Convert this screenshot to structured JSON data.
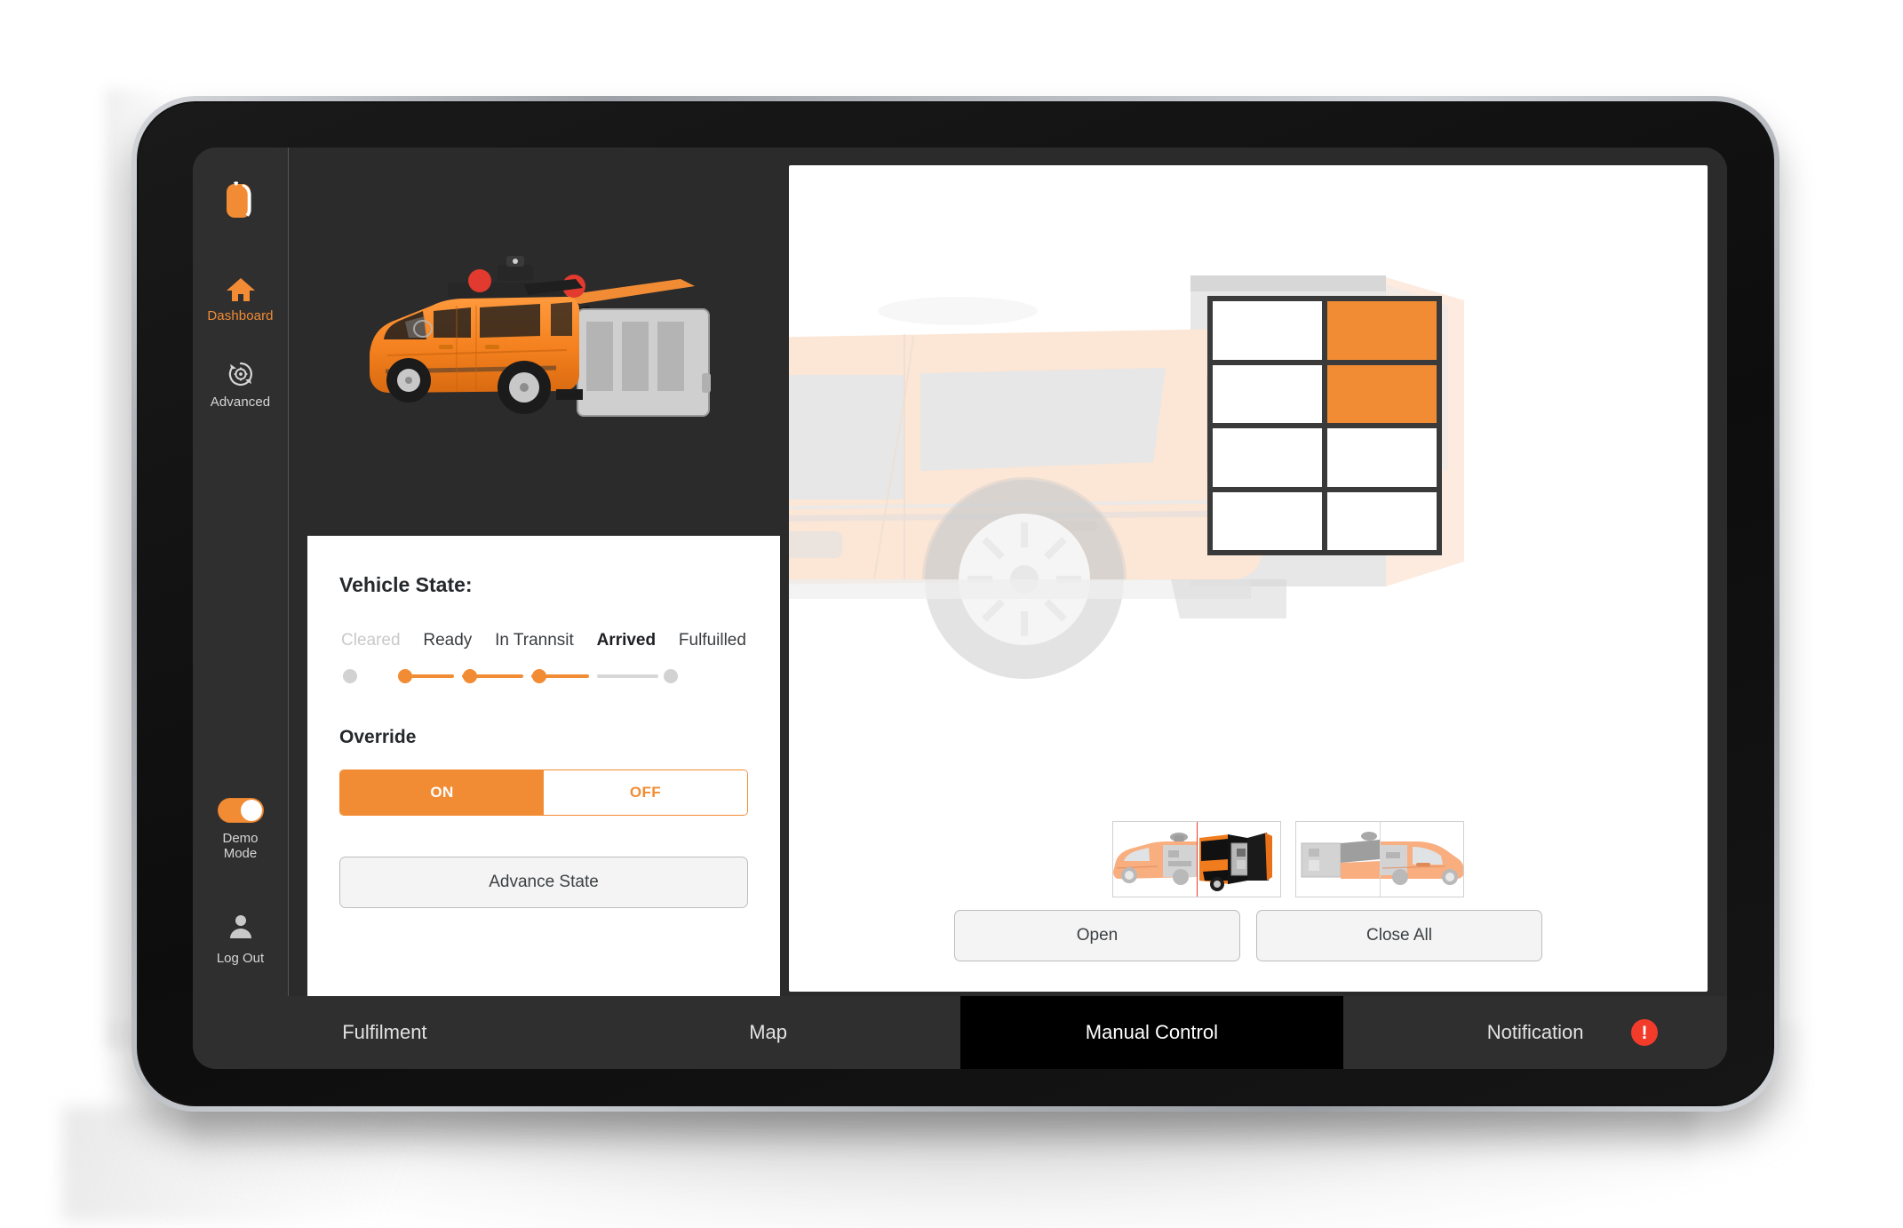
{
  "app": {
    "accent": "#F28C34",
    "screen_bg": "#2b2b2b",
    "sidebar_bg": "#2f2f2f",
    "alert_red": "#f23b2a"
  },
  "sidebar": {
    "logo_name": "app-logo",
    "items": [
      {
        "label": "Dashboard",
        "icon": "home-icon",
        "active": true
      },
      {
        "label": "Advanced",
        "icon": "gear-refresh-icon",
        "active": false
      }
    ],
    "demo_mode": {
      "label": "Demo\nMode",
      "label_line1": "Demo",
      "label_line2": "Mode",
      "state": "on"
    },
    "logout": {
      "label": "Log Out",
      "icon": "user-icon"
    }
  },
  "vehicle_panel": {
    "hero_image_name": "van-3d-render",
    "card_title": "Vehicle State:",
    "states": [
      {
        "label": "Cleared",
        "style": "dim",
        "dot": "grey"
      },
      {
        "label": "Ready",
        "style": "normal",
        "dot": "orange"
      },
      {
        "label": "In Trannsit",
        "style": "normal",
        "dot": "orange"
      },
      {
        "label": "Arrived",
        "style": "active",
        "dot": "orange"
      },
      {
        "label": "Fulfuilled",
        "style": "normal",
        "dot": "grey"
      }
    ],
    "override": {
      "title": "Override",
      "on_label": "ON",
      "off_label": "OFF",
      "selected": "ON"
    },
    "advance_button": "Advance State"
  },
  "control_panel": {
    "background_image_name": "van-side-faded",
    "locker": {
      "name": "locker-grid",
      "rows": 4,
      "columns": 2,
      "cells": [
        {
          "id": "r1c1",
          "state": "empty"
        },
        {
          "id": "r1c2",
          "state": "filled"
        },
        {
          "id": "r2c1",
          "state": "empty"
        },
        {
          "id": "r2c2",
          "state": "filled"
        },
        {
          "id": "r3c1",
          "state": "empty"
        },
        {
          "id": "r3c2",
          "state": "empty"
        },
        {
          "id": "r4c1",
          "state": "empty"
        },
        {
          "id": "r4c2",
          "state": "empty"
        }
      ]
    },
    "thumbnails": [
      {
        "name": "thumb-van-left-front",
        "selected": false,
        "view": "van-side-left-half"
      },
      {
        "name": "thumb-van-left-rear",
        "selected": true,
        "view": "van-rear-open"
      },
      {
        "name": "thumb-van-right-rear",
        "selected": false,
        "view": "van-side-right-half-a"
      },
      {
        "name": "thumb-van-right-front",
        "selected": false,
        "view": "van-side-right-half-b"
      }
    ],
    "buttons": [
      {
        "label": "Open",
        "name": "open-button"
      },
      {
        "label": "Close All",
        "name": "close-all-button"
      }
    ]
  },
  "tabs": [
    {
      "label": "Fulfilment",
      "active": false,
      "badge": null
    },
    {
      "label": "Map",
      "active": false,
      "badge": null
    },
    {
      "label": "Manual Control",
      "active": true,
      "badge": null
    },
    {
      "label": "Notification",
      "active": false,
      "badge": "!"
    }
  ]
}
